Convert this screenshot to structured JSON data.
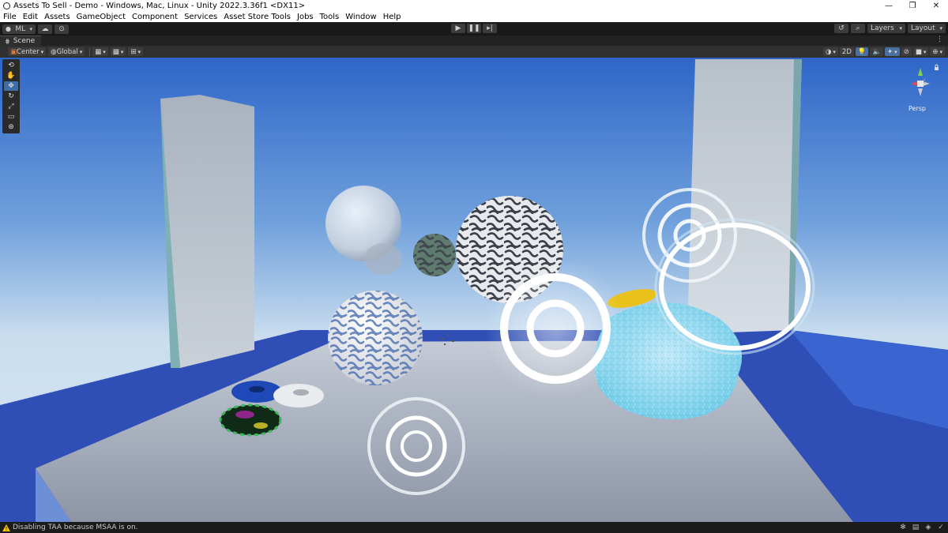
{
  "window": {
    "title": "Assets To Sell - Demo - Windows, Mac, Linux - Unity 2022.3.36f1 <DX11>",
    "minimize_glyph": "—",
    "restore_glyph": "❐",
    "close_glyph": "✕"
  },
  "menu": [
    "File",
    "Edit",
    "Assets",
    "GameObject",
    "Component",
    "Services",
    "Asset Store Tools",
    "Jobs",
    "Tools",
    "Window",
    "Help"
  ],
  "toolbar": {
    "account_label": "ML",
    "layers_label": "Layers",
    "layout_label": "Layout"
  },
  "scene_tab": {
    "label": "Scene",
    "menu_glyph": "⋮"
  },
  "scene_toolbar": {
    "pivot_label": "Center",
    "space_label": "Global",
    "mode_2d_label": "2D"
  },
  "gizmo": {
    "projection_label": "Persp"
  },
  "status": {
    "message": "Disabling TAA because MSAA is on."
  },
  "icons": {
    "warning": "warning-icon",
    "play": "play-icon",
    "pause": "pause-icon",
    "step": "step-icon"
  },
  "colors": {
    "accent_active": "#3f6ea6",
    "sky_top": "#2f66c8",
    "sky_bottom": "#dbe9f3",
    "warning": "#f2c200"
  }
}
